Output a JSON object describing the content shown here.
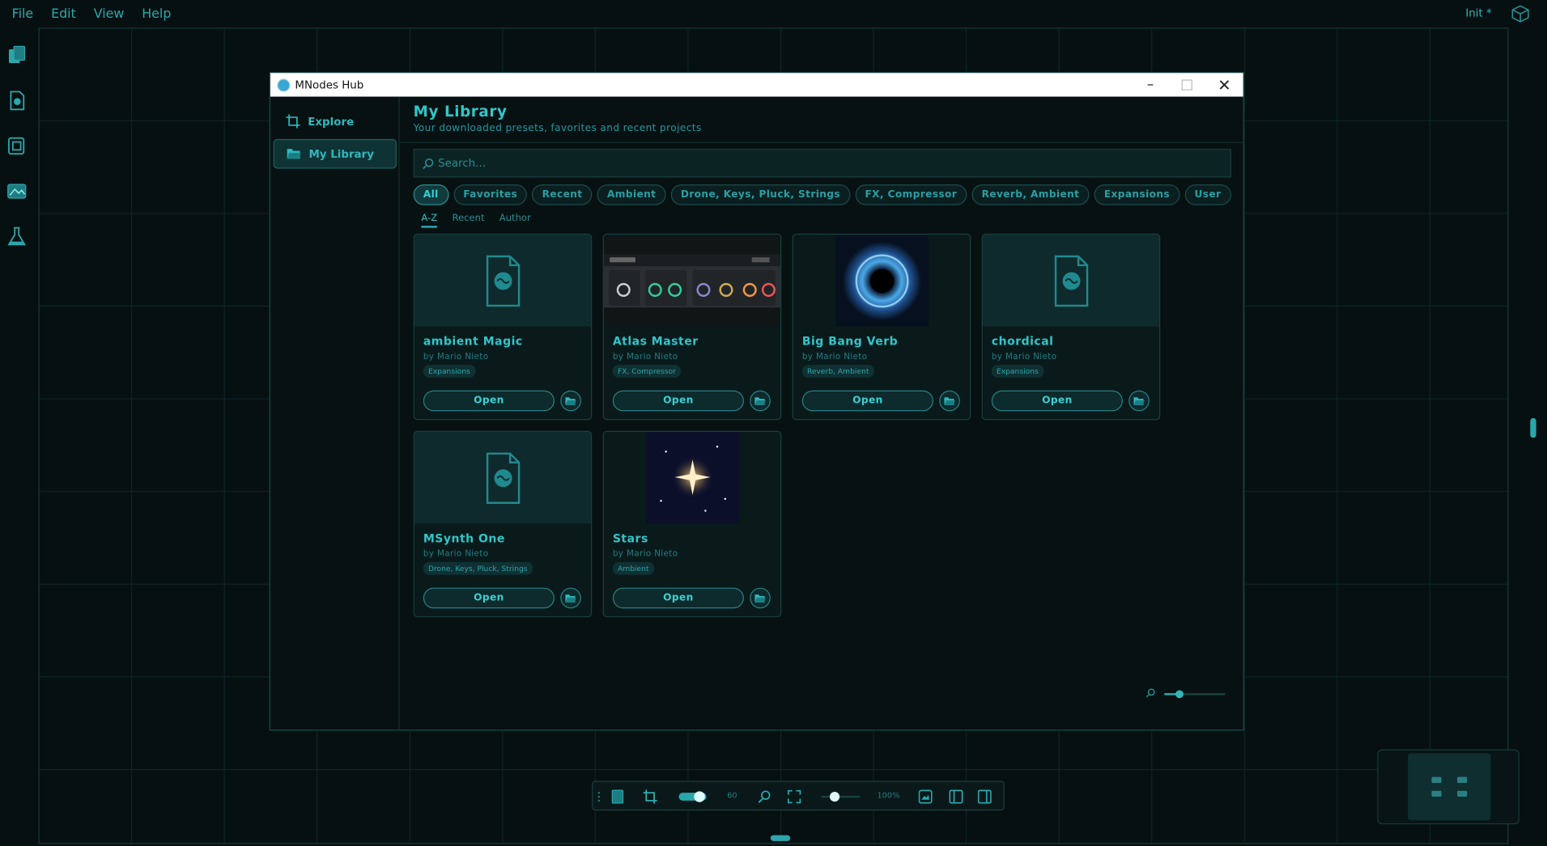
{
  "menubar": {
    "items": [
      "File",
      "Edit",
      "View",
      "Help"
    ],
    "project": "Init *"
  },
  "window": {
    "title": "MNodes Hub"
  },
  "sidebar": {
    "items": [
      {
        "label": "Explore",
        "icon": "crop-frame-icon"
      },
      {
        "label": "My Library",
        "icon": "folder-open-icon"
      }
    ],
    "active": 1
  },
  "main": {
    "title": "My Library",
    "subtitle": "Your downloaded presets, favorites and recent projects"
  },
  "search": {
    "placeholder": "Search..."
  },
  "filters": [
    "All",
    "Favorites",
    "Recent",
    "Ambient",
    "Drone, Keys, Pluck, Strings",
    "FX, Compressor",
    "Reverb, Ambient",
    "Expansions",
    "User"
  ],
  "active_filter": "All",
  "sort": [
    "A-Z",
    "Recent",
    "Author"
  ],
  "active_sort": "A-Z",
  "presets": [
    {
      "name": "ambient Magic",
      "author": "by Mario Nieto",
      "tag": "Expansions",
      "thumb": "file-icon",
      "open": "Open"
    },
    {
      "name": "Atlas Master",
      "author": "by Mario Nieto",
      "tag": "FX, Compressor",
      "thumb": "plugin-screenshot",
      "open": "Open"
    },
    {
      "name": "Big Bang Verb",
      "author": "by Mario Nieto",
      "tag": "Reverb, Ambient",
      "thumb": "energy-orb-image",
      "open": "Open"
    },
    {
      "name": "chordical",
      "author": "by Mario Nieto",
      "tag": "Expansions",
      "thumb": "file-icon",
      "open": "Open"
    },
    {
      "name": "MSynth One",
      "author": "by Mario Nieto",
      "tag": "Drone, Keys, Pluck, Strings",
      "thumb": "file-icon",
      "open": "Open"
    },
    {
      "name": "Stars",
      "author": "by Mario Nieto",
      "tag": "Ambient",
      "thumb": "star-image",
      "open": "Open"
    }
  ],
  "toolbar": {
    "value_a": "60",
    "zoom": "100%",
    "slider_fraction": 0.3
  },
  "thumbnail_zoom_fraction": 0.25,
  "colors": {
    "accent": "#2fb7bc",
    "background": "#071011",
    "panel": "#0a1a1b"
  }
}
